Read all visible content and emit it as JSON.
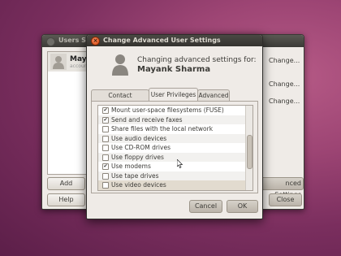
{
  "bg_window": {
    "title": "Users Se",
    "user": {
      "name": "Maya",
      "sub": "accoun"
    },
    "change_labels": [
      "Change...",
      "Change...",
      "Change..."
    ],
    "add_label": "Add",
    "help_label": "Help",
    "advanced_label": "nced Settings",
    "close_label": "Close"
  },
  "dialog": {
    "title": "Change Advanced User Settings",
    "heading": "Changing advanced settings for:",
    "user_name": "Mayank Sharma",
    "tabs": [
      {
        "label": "Contact Information",
        "active": false
      },
      {
        "label": "User Privileges",
        "active": true
      },
      {
        "label": "Advanced",
        "active": false
      }
    ],
    "privileges": [
      {
        "label": "Mount user-space filesystems (FUSE)",
        "checked": true
      },
      {
        "label": "Send and receive faxes",
        "checked": true
      },
      {
        "label": "Share files with the local network",
        "checked": false
      },
      {
        "label": "Use audio devices",
        "checked": false
      },
      {
        "label": "Use CD-ROM drives",
        "checked": false
      },
      {
        "label": "Use floppy drives",
        "checked": false
      },
      {
        "label": "Use modems",
        "checked": true
      },
      {
        "label": "Use tape drives",
        "checked": false
      },
      {
        "label": "Use video devices",
        "checked": false
      }
    ],
    "cancel_label": "Cancel",
    "ok_label": "OK"
  }
}
